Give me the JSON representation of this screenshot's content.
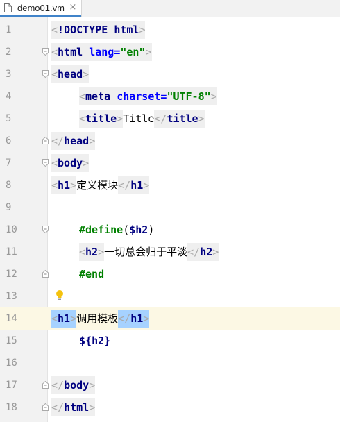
{
  "tab": {
    "title": "demo01.vm",
    "close": "×"
  },
  "lines": [
    {
      "n": "1"
    },
    {
      "n": "2"
    },
    {
      "n": "3"
    },
    {
      "n": "4"
    },
    {
      "n": "5"
    },
    {
      "n": "6"
    },
    {
      "n": "7"
    },
    {
      "n": "8"
    },
    {
      "n": "9"
    },
    {
      "n": "10"
    },
    {
      "n": "11"
    },
    {
      "n": "12"
    },
    {
      "n": "13"
    },
    {
      "n": "14"
    },
    {
      "n": "15"
    },
    {
      "n": "16"
    },
    {
      "n": "17"
    },
    {
      "n": "18"
    }
  ],
  "tokens": {
    "lt": "<",
    "gt": ">",
    "lts": "</",
    "doctype": "!DOCTYPE",
    "html": "html",
    "lang_attr": "lang",
    "eq": "=",
    "lang_val": "\"en\"",
    "head": "head",
    "meta": "meta",
    "charset_attr": "charset",
    "charset_val": "\"UTF-8\"",
    "title": "title",
    "title_text": "Title",
    "body": "body",
    "h1": "h1",
    "h1_text_1": "定义模块",
    "define": "#define",
    "lparen": "(",
    "rparen": ")",
    "h2_var": "$h2",
    "h2": "h2",
    "h2_text": "一切总会归于平淡",
    "end": "#end",
    "h1_text_2": "调用模板",
    "ref_open": "${",
    "ref_name": "h2",
    "ref_close": "}"
  },
  "colors": {
    "tag": "#000080",
    "attr": "#0000ff",
    "value": "#008000",
    "bracket": "#aaaaaa",
    "selection": "#a6d2ff",
    "current_line": "#fcf8e4"
  },
  "icons": {
    "file": "file-icon",
    "fold": "fold-marker-icon",
    "bulb": "lightbulb-icon"
  }
}
